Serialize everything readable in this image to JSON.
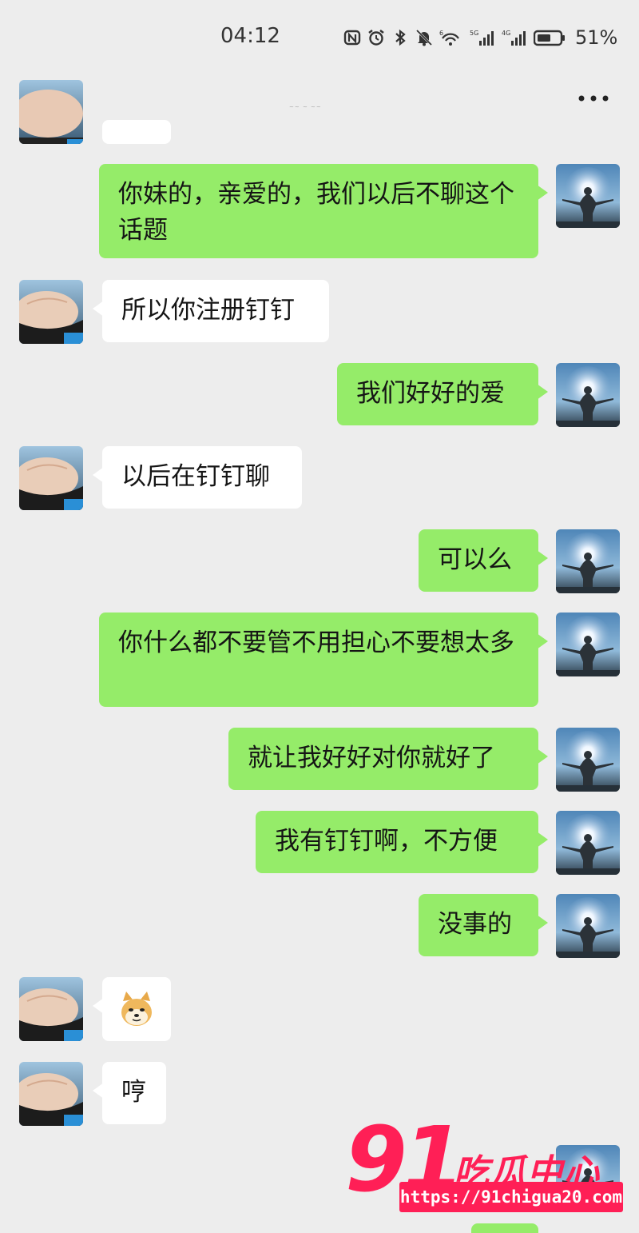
{
  "status": {
    "time": "04:12",
    "battery": "51%",
    "net1": "5G",
    "net2": "4G"
  },
  "nav": {
    "title": "~~ ~ ~~"
  },
  "messages": [
    {
      "side": "right",
      "text": "你妹的，亲爱的，我们以后不聊这个话题"
    },
    {
      "side": "left",
      "text": "所以你注册钉钉"
    },
    {
      "side": "right",
      "text": "我们好好的爱"
    },
    {
      "side": "left",
      "text": "以后在钉钉聊"
    },
    {
      "side": "right",
      "text": "可以么"
    },
    {
      "side": "right",
      "text": "你什么都不要管不用担心不要想太多"
    },
    {
      "side": "right",
      "text": "就让我好好对你就好了"
    },
    {
      "side": "right",
      "text": "我有钉钉啊，不方便"
    },
    {
      "side": "right",
      "text": "没事的"
    },
    {
      "side": "left",
      "text": "",
      "sticker": "doge-emoji"
    },
    {
      "side": "left",
      "text": "哼"
    }
  ],
  "watermark": {
    "number": "91",
    "title": "吃瓜中心",
    "url": "https://91chigua20.com"
  },
  "colors": {
    "green_bubble": "#95ec69",
    "white_bubble": "#ffffff",
    "background": "#ededed",
    "watermark": "#ff1f56"
  },
  "icons": {
    "back": "chevron-left-icon",
    "more": "more-dots-icon"
  }
}
